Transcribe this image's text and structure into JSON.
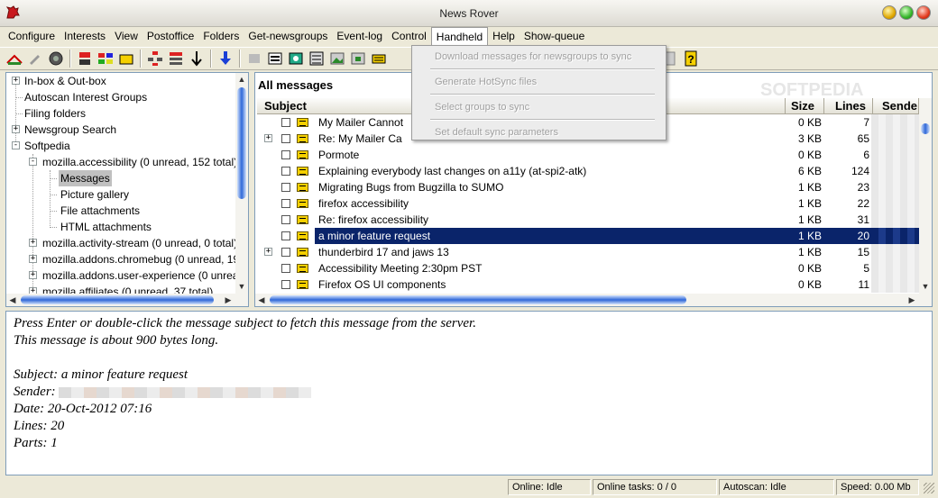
{
  "window": {
    "title": "News Rover"
  },
  "menu": [
    "Configure",
    "Interests",
    "View",
    "Postoffice",
    "Folders",
    "Get-newsgroups",
    "Event-log",
    "Control",
    "Handheld",
    "Help",
    "Show-queue"
  ],
  "handheld_menu": {
    "items": [
      "Download messages for newsgroups to sync",
      "Generate HotSync files",
      "Select groups to sync",
      "Set default sync parameters"
    ]
  },
  "watermark": "SOFTPEDIA",
  "tree": {
    "items": [
      {
        "label": "In-box & Out-box",
        "level": 0,
        "expander": "+"
      },
      {
        "label": "Autoscan Interest Groups",
        "level": 0,
        "expander": ""
      },
      {
        "label": "Filing folders",
        "level": 0,
        "expander": ""
      },
      {
        "label": "Newsgroup Search",
        "level": 0,
        "expander": "+"
      },
      {
        "label": "Softpedia",
        "level": 0,
        "expander": "-"
      },
      {
        "label": "mozilla.accessibility (0 unread, 152 total)",
        "level": 1,
        "expander": "-"
      },
      {
        "label": "Messages",
        "level": 2,
        "expander": "",
        "selected": true
      },
      {
        "label": "Picture gallery",
        "level": 2,
        "expander": ""
      },
      {
        "label": "File attachments",
        "level": 2,
        "expander": ""
      },
      {
        "label": "HTML attachments",
        "level": 2,
        "expander": ""
      },
      {
        "label": "mozilla.activity-stream (0 unread, 0 total)",
        "level": 1,
        "expander": "+"
      },
      {
        "label": "mozilla.addons.chromebug (0 unread, 19",
        "level": 1,
        "expander": "+"
      },
      {
        "label": "mozilla.addons.user-experience (0 unrea",
        "level": 1,
        "expander": "+"
      },
      {
        "label": "mozilla.affiliates (0 unread, 37 total)",
        "level": 1,
        "expander": "+"
      }
    ]
  },
  "messages": {
    "folder_title": "All messages",
    "columns": {
      "subject": "Subject",
      "size": "Size",
      "lines": "Lines",
      "sender": "Sende"
    },
    "rows": [
      {
        "subject": "My Mailer Cannot",
        "size": "0 KB",
        "lines": "7",
        "expander": ""
      },
      {
        "subject": "Re: My Mailer Ca",
        "size": "3 KB",
        "lines": "65",
        "expander": "+"
      },
      {
        "subject": "Pormote",
        "size": "0 KB",
        "lines": "6",
        "expander": ""
      },
      {
        "subject": "Explaining everybody last changes on a11y (at-spi2-atk)",
        "size": "6 KB",
        "lines": "124",
        "expander": ""
      },
      {
        "subject": "Migrating Bugs from Bugzilla to SUMO",
        "size": "1 KB",
        "lines": "23",
        "expander": ""
      },
      {
        "subject": "firefox accessibility",
        "size": "1 KB",
        "lines": "22",
        "expander": ""
      },
      {
        "subject": "Re: firefox accessibility",
        "size": "1 KB",
        "lines": "31",
        "expander": ""
      },
      {
        "subject": "a minor feature request",
        "size": "1 KB",
        "lines": "20",
        "expander": "",
        "selected": true
      },
      {
        "subject": "thunderbird 17 and jaws 13",
        "size": "1 KB",
        "lines": "15",
        "expander": "+"
      },
      {
        "subject": "Accessibility Meeting 2:30pm PST",
        "size": "0 KB",
        "lines": "5",
        "expander": ""
      },
      {
        "subject": "Firefox OS UI components",
        "size": "0 KB",
        "lines": "11",
        "expander": ""
      }
    ]
  },
  "preview": {
    "line1": "Press Enter or double-click the message subject to fetch this message from the server.",
    "line2": "This message is about 900 bytes long.",
    "subject": "Subject: a minor feature request",
    "sender_label": "Sender:",
    "date": "Date: 20-Oct-2012 07:16",
    "lines": "Lines: 20",
    "parts": "Parts: 1"
  },
  "status": {
    "online": "Online: Idle",
    "tasks": "Online tasks: 0 / 0",
    "autoscan": "Autoscan: Idle",
    "speed": "Speed: 0.00 Mb"
  },
  "toolbar_icons": [
    "get-mail-icon",
    "edit-icon",
    "globe-icon",
    "sync-icon",
    "newsgroups-icon",
    "folder-icon",
    "tree-icon",
    "list-icon",
    "down-arrow-icon",
    "blue-down-arrow-icon",
    "print-icon",
    "view-icon",
    "search-icon",
    "properties-icon",
    "image-icon",
    "attach-icon",
    "message-icon",
    "clipboard-icon",
    "help-icon"
  ]
}
